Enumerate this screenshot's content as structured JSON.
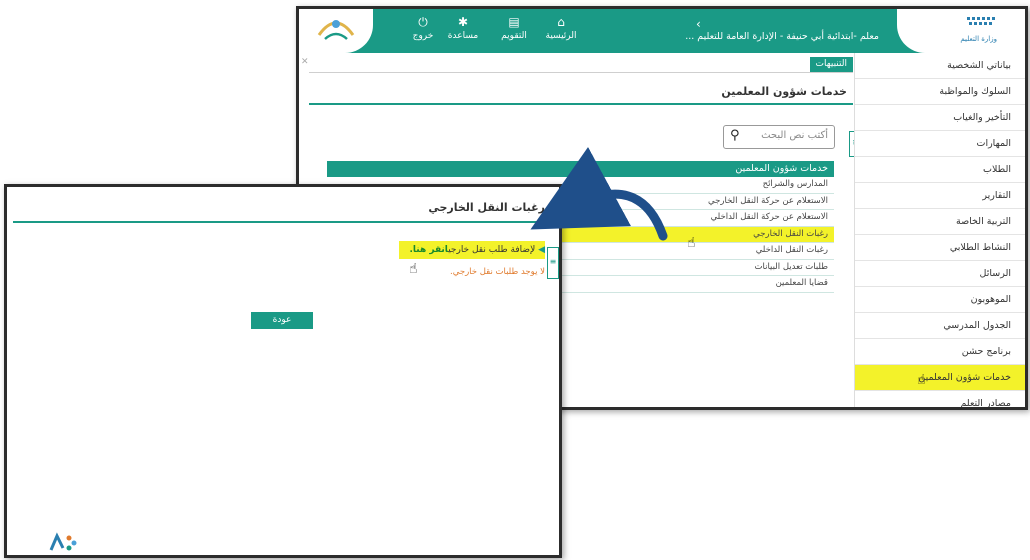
{
  "header": {
    "title": "معلم -ابتدائية أبي حنيفة - الإدارة العامة للتعليم ...",
    "nav": [
      {
        "label": "خروج",
        "icon": "power-icon"
      },
      {
        "label": "مساعدة",
        "icon": "gear-icon"
      },
      {
        "label": "التقويم",
        "icon": "calendar-icon"
      },
      {
        "label": "الرئيسية",
        "icon": "home-icon"
      }
    ],
    "logo_right_text": "وزارة التعليم"
  },
  "notifications_tab": "التنبيهات",
  "page_title": "خدمات شؤون المعلمين",
  "search": {
    "placeholder": "أكتب نص البحث"
  },
  "services": {
    "header": "خدمات شؤون المعلمين",
    "items": [
      "المدارس والشرائح",
      "الاستعلام عن حركة النقل الخارجي",
      "الاستعلام عن حركة النقل الداخلي",
      "رغبات النقل الخارجي",
      "رغبات النقل الداخلي",
      "طلبات تعديل البيانات",
      "قضايا المعلمين"
    ],
    "active_index": 3
  },
  "sidebar": {
    "items": [
      "بياناتي الشخصية",
      "السلوك والمواظبة",
      "التأخير والغياب",
      "المهارات",
      "الطلاب",
      "التقارير",
      "التربية الخاصة",
      "النشاط الطلابي",
      "الرسائل",
      "الموهوبون",
      "الجدول المدرسي",
      "برنامج حشن",
      "خدمات شؤون المعلمين",
      "مصادر التعلم"
    ],
    "active_index": 12
  },
  "dialog": {
    "title": "رغبات النقل الخارجي",
    "add_link": "لإضافة طلب نقل خارجي",
    "add_link_click": "انقر هنا.",
    "empty_message": "لا يوجد طلبات نقل خارجي.",
    "back_button": "عودة"
  },
  "colors": {
    "brand": "#1a9a86",
    "highlight": "#f3f22a",
    "warning": "#e07a2c"
  }
}
